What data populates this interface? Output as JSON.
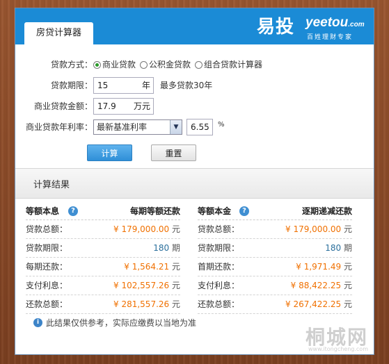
{
  "header": {
    "tab_label": "房贷计算器",
    "brand_cn": "易投",
    "brand_en": "yeetou",
    "brand_en_suffix": ".com",
    "brand_slogan": "百姓理财专家"
  },
  "form": {
    "loan_type_label": "贷款方式：",
    "loan_types": [
      "商业贷款",
      "公积金贷款",
      "组合贷款计算器"
    ],
    "loan_type_selected": "商业贷款",
    "term_label": "贷款期限：",
    "term_value": "15",
    "term_unit": "年",
    "term_hint": "最多贷款30年",
    "amount_label": "商业贷款金额：",
    "amount_value": "17.9",
    "amount_unit": "万元",
    "rate_label": "商业贷款年利率：",
    "rate_select_value": "最新基准利率",
    "rate_value": "6.55",
    "rate_unit": "%",
    "calc_button": "计算",
    "reset_button": "重置"
  },
  "results": {
    "title": "计算结果",
    "left": {
      "method": "等额本息",
      "method_desc": "每期等额还款",
      "items": [
        {
          "label": "贷款总额：",
          "value": "¥ 179,000.00",
          "unit": "元"
        },
        {
          "label": "贷款期限：",
          "value": "180",
          "unit": "期"
        },
        {
          "label": "每期还款：",
          "value": "¥ 1,564.21",
          "unit": "元"
        },
        {
          "label": "支付利息：",
          "value": "¥ 102,557.26",
          "unit": "元"
        },
        {
          "label": "还款总额：",
          "value": "¥ 281,557.26",
          "unit": "元"
        }
      ]
    },
    "right": {
      "method": "等额本金",
      "method_desc": "逐期递减还款",
      "items": [
        {
          "label": "贷款总额：",
          "value": "¥ 179,000.00",
          "unit": "元"
        },
        {
          "label": "贷款期限：",
          "value": "180",
          "unit": "期"
        },
        {
          "label": "首期还款：",
          "value": "¥ 1,971.49",
          "unit": "元"
        },
        {
          "label": "支付利息：",
          "value": "¥ 88,422.25",
          "unit": "元"
        },
        {
          "label": "还款总额：",
          "value": "¥ 267,422.25",
          "unit": "元"
        }
      ]
    },
    "note": "此结果仅供参考，实际应缴费以当地为准"
  },
  "watermark": {
    "text": "桐城网",
    "url": "www.itongcheng.com"
  },
  "colors": {
    "header_blue": "#1b8bd6",
    "value_orange": "#f07000",
    "button_blue": "#2f8fd8"
  }
}
